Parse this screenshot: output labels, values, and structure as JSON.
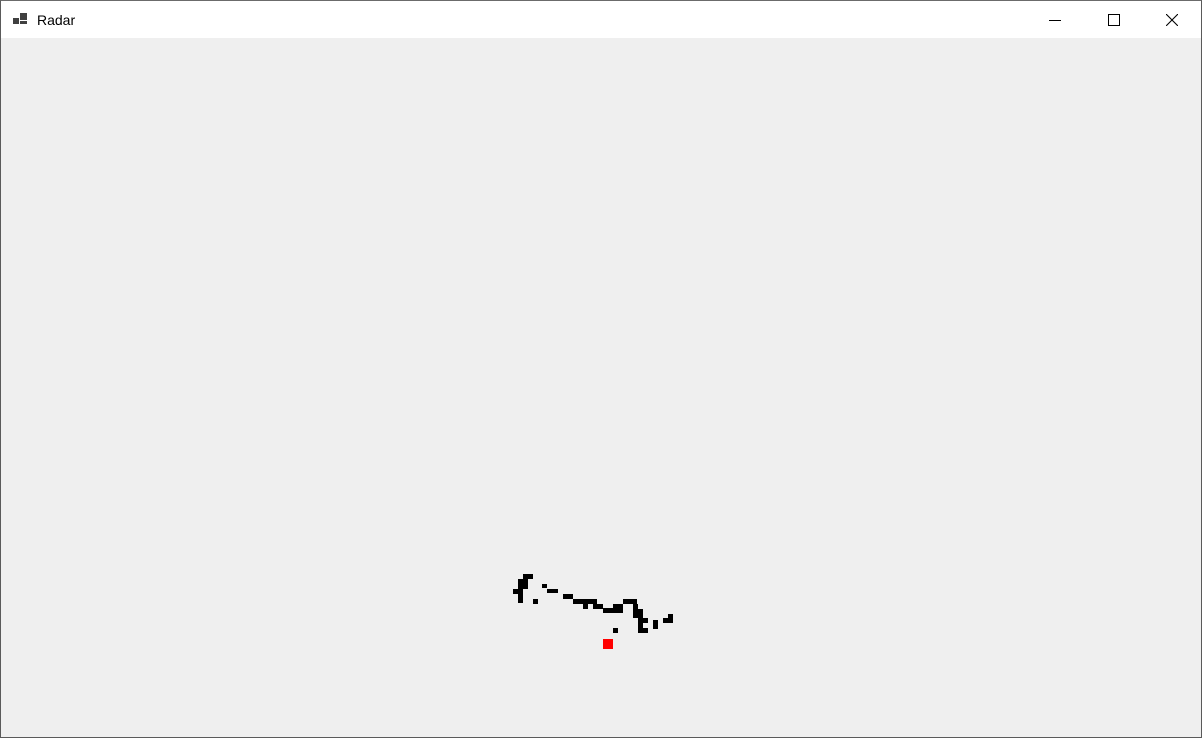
{
  "window": {
    "title": "Radar",
    "icon": "app-window-icon",
    "controls": {
      "minimize_icon": "minimize-icon",
      "maximize_icon": "maximize-icon",
      "close_icon": "close-icon"
    }
  },
  "radar": {
    "background_color": "#efefef",
    "point_color": "#000000",
    "origin_color": "#ff0000"
  }
}
